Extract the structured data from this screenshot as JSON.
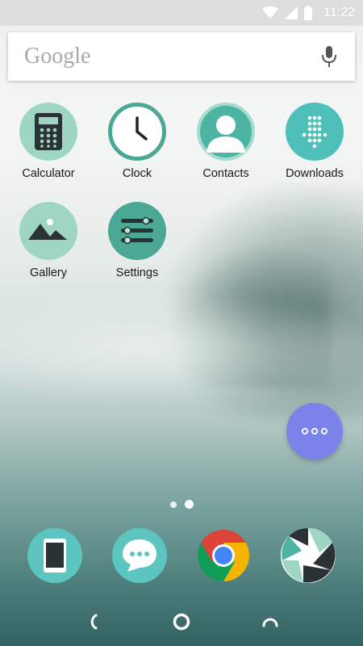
{
  "status_bar": {
    "time": "11:22",
    "icons": [
      "wifi-icon",
      "signal-icon",
      "battery-icon"
    ]
  },
  "search": {
    "logo": "Google",
    "mic_icon": "mic-icon"
  },
  "apps": [
    {
      "label": "Calculator",
      "icon": "calculator-icon",
      "color": "#9fd6c2"
    },
    {
      "label": "Clock",
      "icon": "clock-icon",
      "color": "#ffffff"
    },
    {
      "label": "Contacts",
      "icon": "contacts-icon",
      "color": "#4db3a2"
    },
    {
      "label": "Downloads",
      "icon": "downloads-icon",
      "color": "#4fbfb9"
    },
    {
      "label": "Gallery",
      "icon": "gallery-icon",
      "color": "#9fd6c2"
    },
    {
      "label": "Settings",
      "icon": "settings-icon",
      "color": "#4aa895"
    }
  ],
  "fab": {
    "icon": "more-dots-icon",
    "color": "#7b83eb"
  },
  "page_indicator": {
    "pages": 2,
    "current": 2
  },
  "dock": [
    {
      "name": "phone",
      "icon": "phone-icon",
      "color": "#5cc5c0"
    },
    {
      "name": "messages",
      "icon": "messages-icon",
      "color": "#5cc5c0"
    },
    {
      "name": "chrome",
      "icon": "chrome-icon"
    },
    {
      "name": "camera",
      "icon": "camera-icon"
    }
  ],
  "nav_bar": {
    "icons": [
      "back-icon",
      "home-icon",
      "recents-icon"
    ]
  }
}
